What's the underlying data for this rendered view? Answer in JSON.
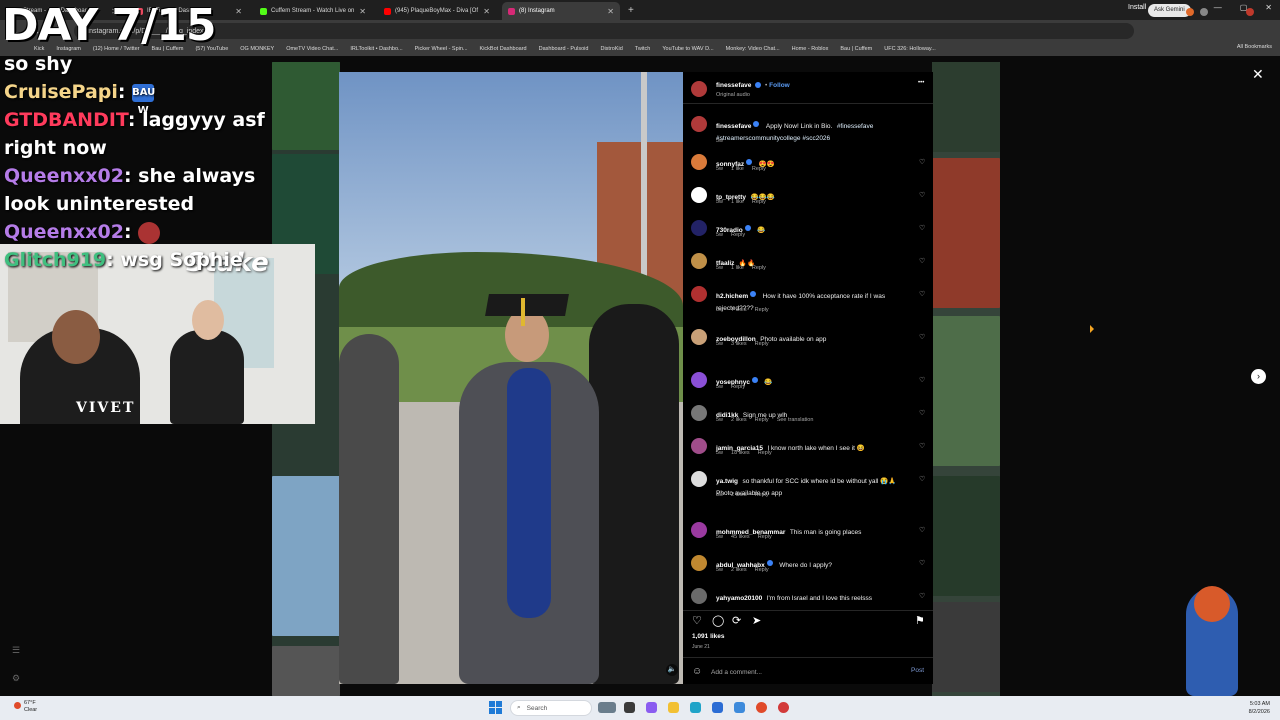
{
  "browser": {
    "tabs": [
      {
        "label": "Stream - Kick Dashboard",
        "color": "#53fc18",
        "active": false
      },
      {
        "label": "IRLToolkit • Dashboard",
        "color": "#e84a5f",
        "active": false
      },
      {
        "label": "Cuffem Stream - Watch Live on",
        "color": "#53fc18",
        "active": false
      },
      {
        "label": "(945) PlaqueBoyMax - Diva [Of",
        "color": "#ff0000",
        "active": false
      },
      {
        "label": "(8) Instagram",
        "color": "#d62976",
        "active": true
      }
    ],
    "new_tab": "+",
    "url": "instagram.com/p/D_____/?img_index=1",
    "install_label": "Install",
    "ask_gemini_label": "Ask Gemini",
    "bookmarks": [
      "Kick",
      "Instagram",
      "(12) Home / Twitter",
      "Bau | Cuffem",
      "(57) YouTube",
      "OG MONKEY",
      "OmeTV Video Chat...",
      "IRLToolkit • Dashbo...",
      "Picker Wheel - Spin...",
      "KickBot Dashboard",
      "Dashboard - Pulsoid",
      "DistroKid",
      "Twitch",
      "YouTube to WAV D...",
      "Monkey: Video Chat...",
      "Home - Roblox",
      "Bau | Cuffem",
      "UFC 326: Holloway..."
    ],
    "all_bookmarks_label": "All Bookmarks"
  },
  "overlay": {
    "title": "DAY 7/15",
    "chat": [
      {
        "user": "",
        "text": "so shy",
        "color": "#ffffff"
      },
      {
        "user": "CruisePapi",
        "text": "",
        "color": "#f5d58a",
        "emote": "BAU W"
      },
      {
        "user": "GTDBANDIT",
        "text": "laggyyy asf right now",
        "color": "#ff3b5c"
      },
      {
        "user": "Queenxx02",
        "text": "she always look uninterested",
        "color": "#b57ce8"
      },
      {
        "user": "Queenxx02",
        "text": "",
        "color": "#b57ce8"
      },
      {
        "user": "Glitch919",
        "text": "wsg Sophie",
        "color": "#3fbf7f"
      }
    ],
    "webcam_shirt": "VIVET",
    "webcam_brand": "Stake"
  },
  "post": {
    "author": "finessefave",
    "follow_label": "Follow",
    "audio_label": "Original audio",
    "caption": {
      "user": "finessefave",
      "text": "Apply Now! Link in Bio.",
      "tags": "#finessefave #streamerscommunitycollege #scc2026",
      "time": "5w"
    },
    "comments": [
      {
        "user": "sonnyfaz",
        "verified": true,
        "text": "😍😍",
        "time": "5w",
        "likes": "1 like",
        "reply": "Reply",
        "avatar": "#d97a3a"
      },
      {
        "user": "tp_tpretty",
        "verified": false,
        "text": "😂😂😂",
        "time": "5w",
        "likes": "1 like",
        "reply": "Reply",
        "avatar": "#ffffff"
      },
      {
        "user": "730radio",
        "verified": true,
        "text": "😂",
        "time": "5w",
        "likes": "",
        "reply": "Reply",
        "avatar": "#222266"
      },
      {
        "user": "tfaaliz",
        "verified": false,
        "text": "🔥🔥",
        "time": "5w",
        "likes": "1 like",
        "reply": "Reply",
        "avatar": "#c09048"
      },
      {
        "user": "h2.hichem",
        "verified": true,
        "text": "How it have 100% acceptance rate if I was rejected????",
        "time": "5w",
        "likes": "7 likes",
        "reply": "Reply",
        "avatar": "#b03030"
      },
      {
        "user": "zoeboydillon",
        "verified": false,
        "text": "Photo available on app",
        "time": "5w",
        "likes": "3 likes",
        "reply": "Reply",
        "avatar": "#c9a077"
      },
      {
        "user": "yosephnyc",
        "verified": true,
        "text": "😂",
        "time": "5w",
        "likes": "",
        "reply": "Reply",
        "avatar": "#8a4fd6"
      },
      {
        "user": "didi1kk",
        "verified": false,
        "text": "Sign me up wlh",
        "time": "5w",
        "likes": "2 likes",
        "reply": "Reply",
        "translate": "See translation",
        "avatar": "#777777"
      },
      {
        "user": "jamin_garcia15",
        "verified": false,
        "text": "I know north lake when I see it 😆",
        "time": "5w",
        "likes": "18 likes",
        "reply": "Reply",
        "avatar": "#a04d8a"
      },
      {
        "user": "ya.twig",
        "verified": false,
        "text": "so thankful for SCC idk where id be without yall 😭🙏 Photo available on app",
        "time": "5w",
        "likes": "2 likes",
        "reply": "Reply",
        "avatar": "#dddddd"
      },
      {
        "user": "mohmmed_benammar",
        "verified": false,
        "text": "This man is going places",
        "time": "5w",
        "likes": "45 likes",
        "reply": "Reply",
        "avatar": "#9a3aa0"
      },
      {
        "user": "abdul_wahhabx",
        "verified": true,
        "text": "Where do I apply?",
        "time": "5w",
        "likes": "2 likes",
        "reply": "Reply",
        "avatar": "#c08830"
      },
      {
        "user": "yahyamo20100",
        "verified": false,
        "text": "I'm from Israel and I love this reelsss",
        "time": "",
        "likes": "",
        "reply": "",
        "avatar": "#6a6a6a"
      }
    ],
    "like_count": "1,091 likes",
    "date": "June 21",
    "comment_placeholder": "Add a comment...",
    "post_label": "Post"
  },
  "taskbar": {
    "weather_temp": "67°F",
    "weather_desc": "Clear",
    "search_placeholder": "Search",
    "time": "5:03 AM",
    "date": "8/2/2026"
  },
  "icons": {
    "close": "✕",
    "next": "›",
    "heart": "♡",
    "comment": "◯",
    "repost": "⟳",
    "share": "➤",
    "save": "⚑",
    "more": "•••"
  }
}
